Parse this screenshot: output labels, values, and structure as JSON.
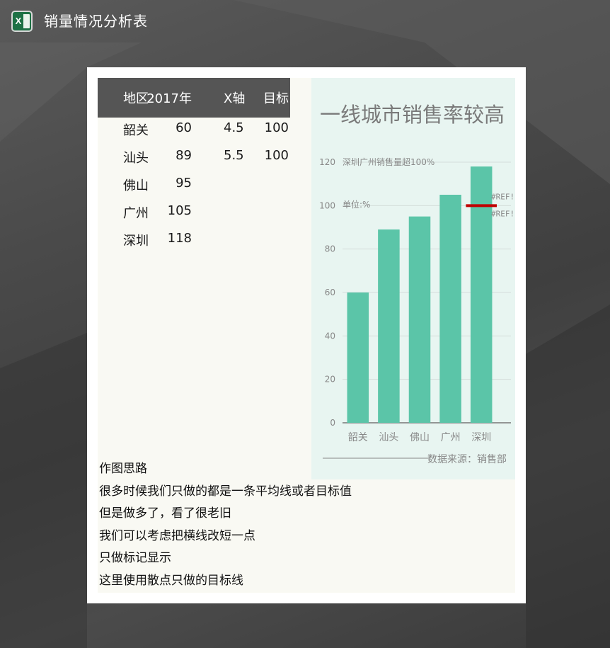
{
  "app": {
    "title": "销量情况分析表",
    "icon": "excel-icon",
    "icon_letter": "X"
  },
  "table": {
    "headers": [
      "地区",
      "2017年",
      "X轴",
      "目标"
    ],
    "rows": [
      [
        "韶关",
        "60",
        "4.5",
        "100"
      ],
      [
        "汕头",
        "89",
        "5.5",
        "100"
      ],
      [
        "佛山",
        "95",
        "",
        ""
      ],
      [
        "广州",
        "105",
        "",
        ""
      ],
      [
        "深圳",
        "118",
        "",
        ""
      ]
    ]
  },
  "notes": [
    "作图思路",
    "很多时候我们只做的都是一条平均线或者目标值",
    "但是做多了，看了很老旧",
    "我们可以考虑把横线改短一点",
    "只做标记显示",
    "这里使用散点只做的目标线"
  ],
  "chart_data": {
    "type": "bar",
    "title": "一线城市销售率较高",
    "annotations": [
      "深圳广州销售量超100%",
      "单位:%"
    ],
    "categories": [
      "韶关",
      "汕头",
      "佛山",
      "广州",
      "深圳"
    ],
    "values": [
      60,
      89,
      95,
      105,
      118
    ],
    "ylim": [
      0,
      120
    ],
    "yticks": [
      "0",
      "20",
      "40",
      "60",
      "80",
      "100",
      "120"
    ],
    "grid": true,
    "target": {
      "value": 100,
      "x": [
        4.5,
        5.5
      ]
    },
    "error_labels": [
      "#REF!",
      "#REF!"
    ],
    "source": "数据来源：销售部",
    "colors": {
      "bar": "#5bc5a8",
      "target": "#c00000",
      "grid": "#d4ddda",
      "text": "#888888",
      "title": "#7a7a7a"
    }
  }
}
